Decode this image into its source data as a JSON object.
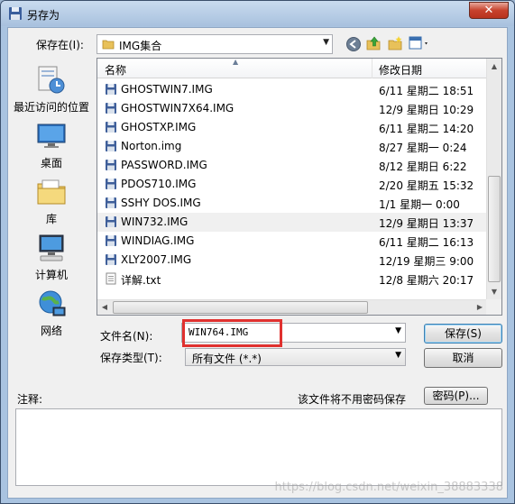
{
  "window": {
    "title": "另存为",
    "close_glyph": "✕"
  },
  "location": {
    "label": "保存在(I):",
    "current_folder": "IMG集合"
  },
  "places": [
    {
      "label": "最近访问的位置",
      "icon": "recent-places-icon"
    },
    {
      "label": "桌面",
      "icon": "desktop-icon"
    },
    {
      "label": "库",
      "icon": "libraries-icon"
    },
    {
      "label": "计算机",
      "icon": "computer-icon"
    },
    {
      "label": "网络",
      "icon": "network-icon"
    }
  ],
  "list": {
    "col_name": "名称",
    "col_date": "修改日期",
    "files": [
      {
        "name": "GHOSTWIN7.IMG",
        "date": "6/11 星期二 18:51",
        "icon": "floppy-disk-icon"
      },
      {
        "name": "GHOSTWIN7X64.IMG",
        "date": "12/9 星期日 10:29",
        "icon": "floppy-disk-icon"
      },
      {
        "name": "GHOSTXP.IMG",
        "date": "6/11 星期二 14:20",
        "icon": "floppy-disk-icon"
      },
      {
        "name": "Norton.img",
        "date": "8/27 星期一 0:24",
        "icon": "floppy-disk-icon"
      },
      {
        "name": "PASSWORD.IMG",
        "date": "8/12 星期日 6:22",
        "icon": "floppy-disk-icon"
      },
      {
        "name": "PDOS710.IMG",
        "date": "2/20 星期五 15:32",
        "icon": "floppy-disk-icon"
      },
      {
        "name": "SSHY DOS.IMG",
        "date": "1/1 星期一 0:00",
        "icon": "floppy-disk-icon"
      },
      {
        "name": "WIN732.IMG",
        "date": "12/9 星期日 13:37",
        "icon": "floppy-disk-icon",
        "selected": true
      },
      {
        "name": "WINDIAG.IMG",
        "date": "6/11 星期二 16:13",
        "icon": "floppy-disk-icon"
      },
      {
        "name": "XLY2007.IMG",
        "date": "12/19 星期三 9:00",
        "icon": "floppy-disk-icon"
      },
      {
        "name": "详解.txt",
        "date": "12/8 星期六 20:17",
        "icon": "text-file-icon"
      }
    ]
  },
  "filename": {
    "label": "文件名(N):",
    "value": "WIN764.IMG"
  },
  "filetype": {
    "label": "保存类型(T):",
    "value": "所有文件 (*.*)"
  },
  "buttons": {
    "save": "保存(S)",
    "cancel": "取消",
    "password": "密码(P)..."
  },
  "notes": {
    "label": "注释:",
    "no_password_note": "该文件将不用密码保存"
  },
  "watermark": "https://blog.csdn.net/weixin_38883338",
  "colors": {
    "highlight": "#e0312f",
    "title_gradient_top": "#c9dbef",
    "close_button": "#c7422d"
  }
}
